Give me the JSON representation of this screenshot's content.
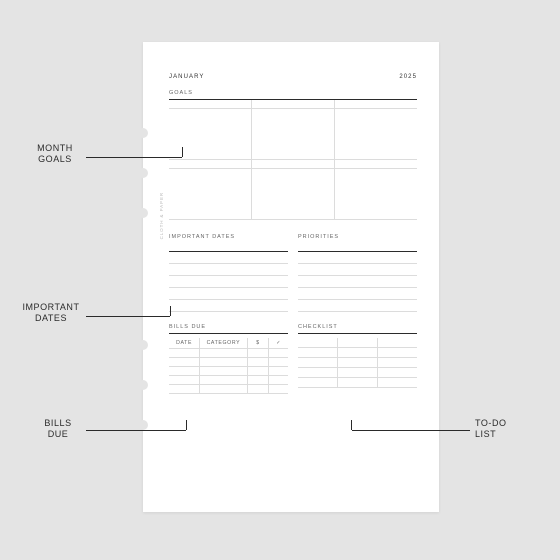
{
  "header": {
    "month": "JANUARY",
    "year": "2025"
  },
  "sections": {
    "goals": "GOALS",
    "important_dates": "IMPORTANT DATES",
    "priorities": "PRIORITIES",
    "bills_due": "BILLS DUE",
    "checklist": "CHECKLIST"
  },
  "bills_columns": {
    "date": "DATE",
    "category": "CATEGORY",
    "amount": "$",
    "done": "✓"
  },
  "brand_side": "CLOTH & PAPER",
  "callouts": {
    "goals_l1": "MONTH",
    "goals_l2": "GOALS",
    "dates_l1": "IMPORTANT",
    "dates_l2": "DATES",
    "bills_l1": "BILLS",
    "bills_l2": "DUE",
    "todo_l1": "TO-DO",
    "todo_l2": "LIST"
  }
}
